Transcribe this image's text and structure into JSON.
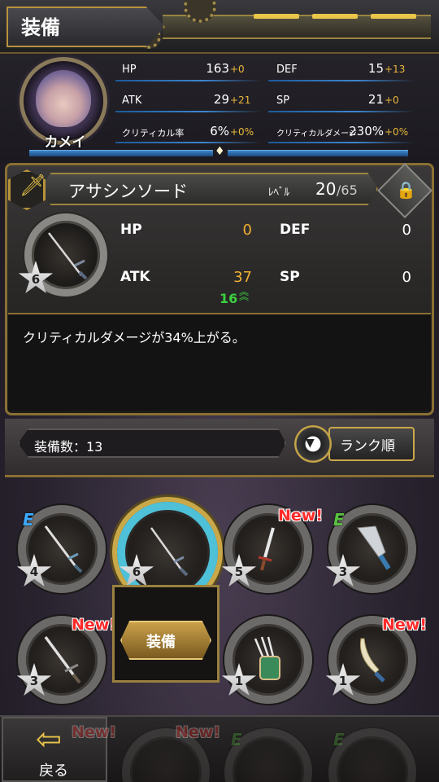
{
  "header": {
    "title": "装備"
  },
  "character": {
    "name": "カメイ",
    "stats": [
      {
        "label": "HP",
        "value": "163",
        "bonus": "+0"
      },
      {
        "label": "DEF",
        "value": "15",
        "bonus": "+13"
      },
      {
        "label": "ATK",
        "value": "29",
        "bonus": "+21"
      },
      {
        "label": "SP",
        "value": "21",
        "bonus": "+0"
      },
      {
        "label": "クリティカル率",
        "value": "6%",
        "bonus": "+0%"
      },
      {
        "label": "クリティカルダメージ",
        "value": "230%",
        "bonus": "+0%"
      }
    ]
  },
  "equipment": {
    "name": "アサシンソード",
    "level_label": "ﾚﾍﾞﾙ",
    "level": "20",
    "level_max": "/65",
    "stars": "6",
    "stats": [
      {
        "label": "HP",
        "value": "0"
      },
      {
        "label": "DEF",
        "value": "0"
      },
      {
        "label": "ATK",
        "value": "37"
      },
      {
        "label": "SP",
        "value": "0"
      }
    ],
    "atk_plus": "16",
    "description": "クリティカルダメージが34%上がる。"
  },
  "sort": {
    "count_label": "装備数：13",
    "sort_button": "ランク順"
  },
  "inventory": {
    "items": [
      {
        "stars": "4",
        "badge": "E",
        "badge_color": "#3ca8ff",
        "weapon": "sword-icon"
      },
      {
        "stars": "6",
        "badge": "",
        "selected": true,
        "weapon": "sword-icon"
      },
      {
        "stars": "5",
        "badge": "New!",
        "weapon": "dagger-icon"
      },
      {
        "stars": "3",
        "badge": "E",
        "badge_color": "#58c040",
        "weapon": "machete-icon"
      },
      {
        "stars": "3",
        "badge": "New!",
        "weapon": "sword-icon"
      },
      {
        "stars": "1",
        "badge": "",
        "weapon": "claw-icon"
      },
      {
        "stars": "1",
        "badge": "New!",
        "weapon": "scimitar-icon"
      }
    ],
    "equip_button": "装備"
  },
  "bottom": {
    "back_label": "戻る",
    "ghost_badges": [
      "New!",
      "New!",
      "E",
      "E"
    ]
  }
}
